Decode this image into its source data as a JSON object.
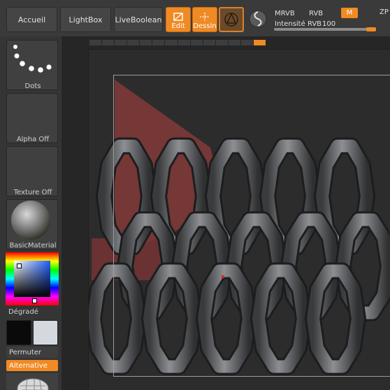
{
  "toolbar": {
    "accueil": "Accueil",
    "lightbox": "LightBox",
    "liveboolean": "LiveBoolean",
    "edit": "Edit",
    "dessin": "Dessin",
    "mrvb": "MRVB",
    "rvb": "RVB",
    "m": "M",
    "zp": "ZP",
    "intensite_label": "Intensité RVB",
    "intensite_value": "100",
    "intensite_fraction": 1.0
  },
  "palette": {
    "dots": "Dots",
    "alpha": "Alpha Off",
    "texture": "Texture Off",
    "material": "BasicMaterial",
    "gradient": "Dégradé",
    "swap": "Permuter",
    "alternative": "Alternative"
  },
  "colors": {
    "accent": "#f08a24",
    "main_color": "#0a0a0a",
    "secondary_color": "#d4d8df"
  },
  "timeline": {
    "segments": 14,
    "active_index": 13
  }
}
